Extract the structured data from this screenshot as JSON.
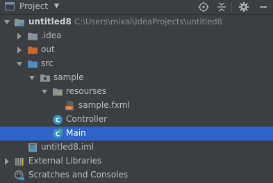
{
  "toolbar": {
    "title": "Project",
    "icons": [
      "project-icon",
      "dropdown-caret-icon",
      "crosshair-icon",
      "collapse-all-icon",
      "gear-icon",
      "hide-panel-icon"
    ]
  },
  "tree": {
    "root": {
      "label": "untitled8",
      "path": "C:\\Users\\mixai\\IdeaProjects\\untitled8"
    },
    "idea": ".idea",
    "out": "out",
    "src": "src",
    "sample": "sample",
    "resourses": "resourses",
    "sample_fxml": "sample.fxml",
    "controller": "Controller",
    "main": "Main",
    "iml": "untitled8.iml",
    "external_libraries": "External Libraries",
    "scratches": "Scratches and Consoles"
  },
  "colors": {
    "panel_bg": "#3c3f41",
    "selection": "#2f65ca",
    "folder": "#87939a",
    "source_folder": "#4a8ec3",
    "excluded_folder": "#c8692e",
    "class_icon": "#3592c4",
    "fxml_icon": "#c8692e"
  }
}
